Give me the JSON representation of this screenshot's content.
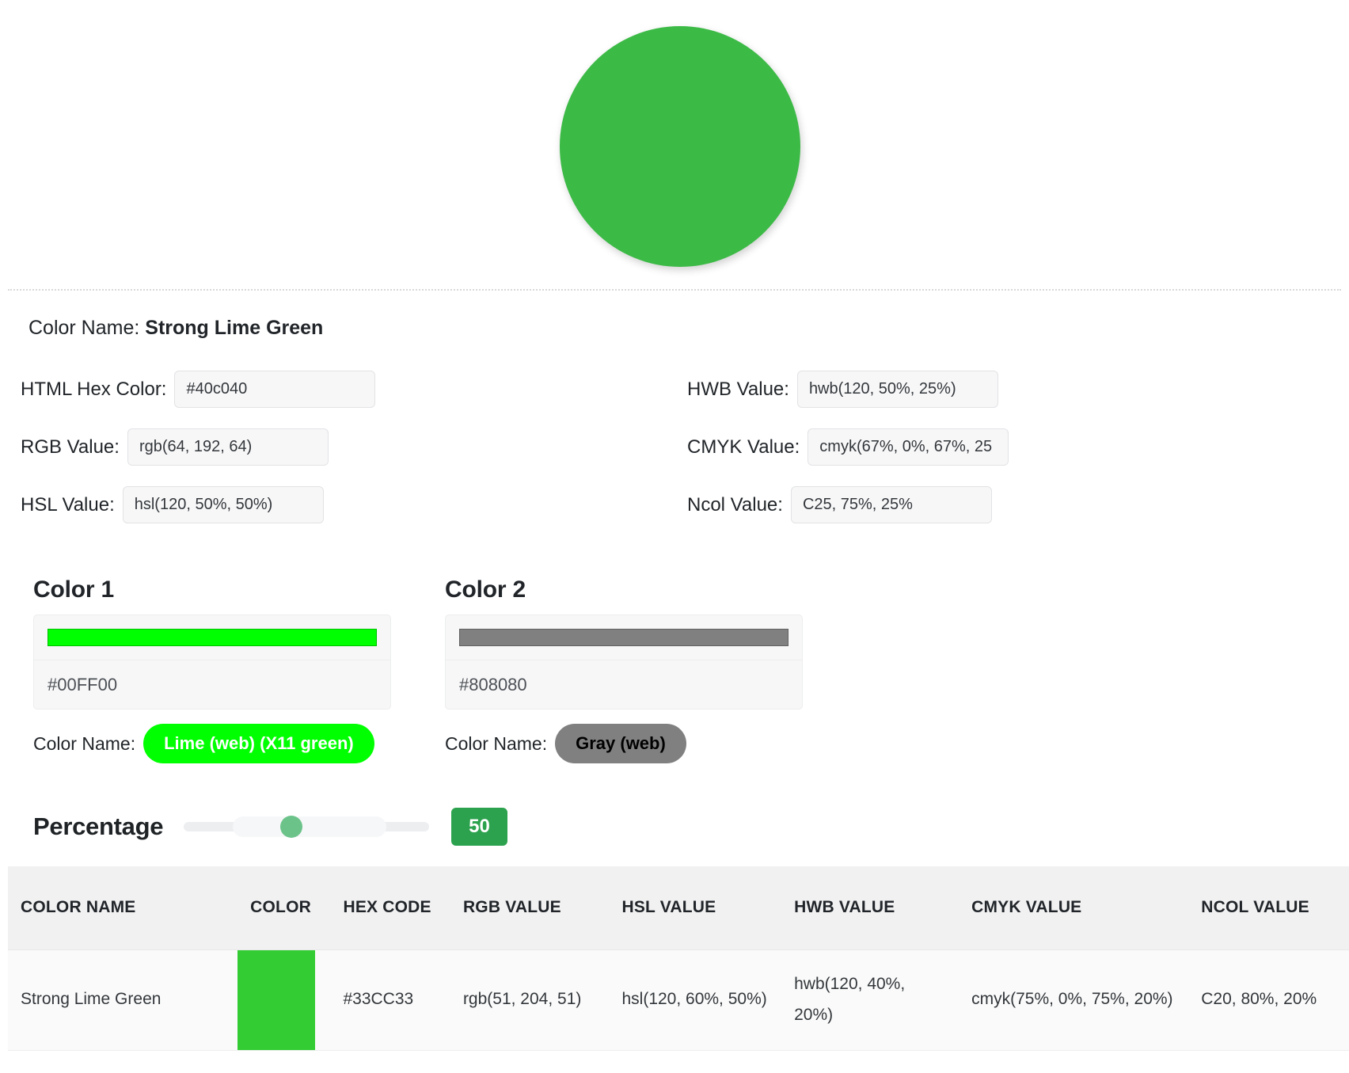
{
  "hero": {
    "circle_color": "#3cba46",
    "circle_name": "color-preview-circle"
  },
  "color_name": {
    "label": "Color Name:",
    "value": "Strong Lime Green"
  },
  "values": {
    "hex": {
      "label": "HTML Hex Color:",
      "value": "#40c040"
    },
    "rgb": {
      "label": "RGB Value:",
      "value": "rgb(64, 192, 64)"
    },
    "hsl": {
      "label": "HSL Value:",
      "value": "hsl(120, 50%, 50%)"
    },
    "hwb": {
      "label": "HWB Value:",
      "value": "hwb(120, 50%, 25%)"
    },
    "cmyk": {
      "label": "CMYK Value:",
      "value": "cmyk(67%, 0%, 67%, 25"
    },
    "ncol": {
      "label": "Ncol Value:",
      "value": "C25, 75%, 25%"
    }
  },
  "pickers": [
    {
      "title": "Color 1",
      "swatch": "#00FF00",
      "hex": "#00FF00",
      "name_label": "Color Name:",
      "name": "Lime (web) (X11 green)",
      "pill_bg": "#00FF00",
      "pill_fg": "#ffffff"
    },
    {
      "title": "Color 2",
      "swatch": "#808080",
      "hex": "#808080",
      "name_label": "Color Name:",
      "name": "Gray (web)",
      "pill_bg": "#808080",
      "pill_fg": "#000000"
    }
  ],
  "percentage": {
    "label": "Percentage",
    "value": "50",
    "badge_color": "#2ca24e",
    "thumb_color": "#6cc38a"
  },
  "chart_data": {
    "type": "table",
    "title": "",
    "columns": [
      "COLOR NAME",
      "COLOR",
      "HEX CODE",
      "RGB VALUE",
      "HSL VALUE",
      "HWB VALUE",
      "CMYK VALUE",
      "NCOL VALUE"
    ],
    "rows": [
      {
        "color_name": "Strong Lime Green",
        "color": "#33CC33",
        "hex_code": "#33CC33",
        "rgb_value": "rgb(51, 204, 51)",
        "hsl_value": "hsl(120, 60%, 50%)",
        "hwb_value": "hwb(120, 40%, 20%)",
        "cmyk_value": "cmyk(75%, 0%, 75%, 20%)",
        "ncol_value": "C20, 80%, 20%"
      }
    ]
  }
}
